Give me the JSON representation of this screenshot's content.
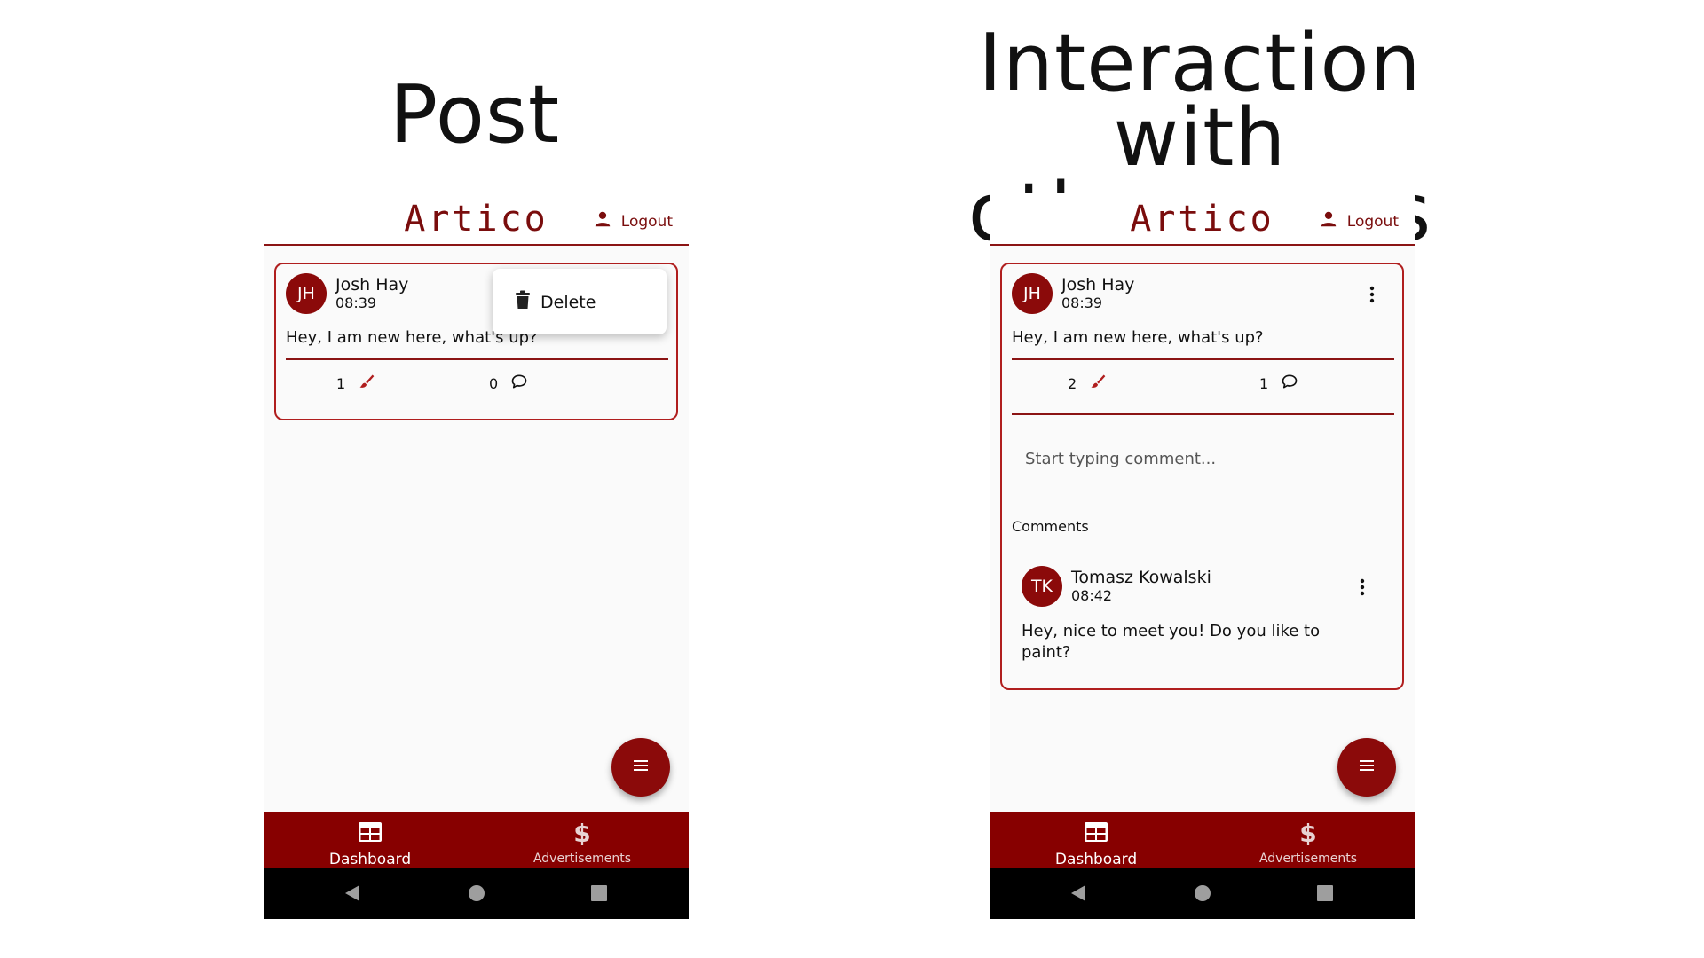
{
  "headings": {
    "left": "Post",
    "right_line1": "Interaction with",
    "right_line2": "other users"
  },
  "app": {
    "brand": "Artico",
    "logout_label": "Logout",
    "fab_icon": "menu-icon",
    "nav": {
      "dashboard_label": "Dashboard",
      "dashboard_icon": "table-icon",
      "ads_label": "Advertisements",
      "ads_icon": "dollar-icon"
    },
    "system_nav_icons": [
      "back-icon",
      "home-icon",
      "recents-icon"
    ],
    "colors": {
      "accent": "#8b0a0a",
      "nav_background": "#870000",
      "background": "#fafafa"
    }
  },
  "screen_left": {
    "post": {
      "avatar_initials": "JH",
      "author": "Josh Hay",
      "time": "08:39",
      "text": "Hey, I am new here, what's up?",
      "likes": "1",
      "comments_count": "0"
    },
    "menu": {
      "delete_label": "Delete",
      "delete_icon": "trash-icon"
    }
  },
  "screen_right": {
    "post": {
      "avatar_initials": "JH",
      "author": "Josh Hay",
      "time": "08:39",
      "text": "Hey, I am new here, what's up?",
      "likes": "2",
      "comments_count": "1"
    },
    "comment_input_placeholder": "Start typing comment...",
    "comments_label": "Comments",
    "comment": {
      "avatar_initials": "TK",
      "author": "Tomasz Kowalski",
      "time": "08:42",
      "text": "Hey, nice to meet you! Do you like to paint?"
    }
  }
}
